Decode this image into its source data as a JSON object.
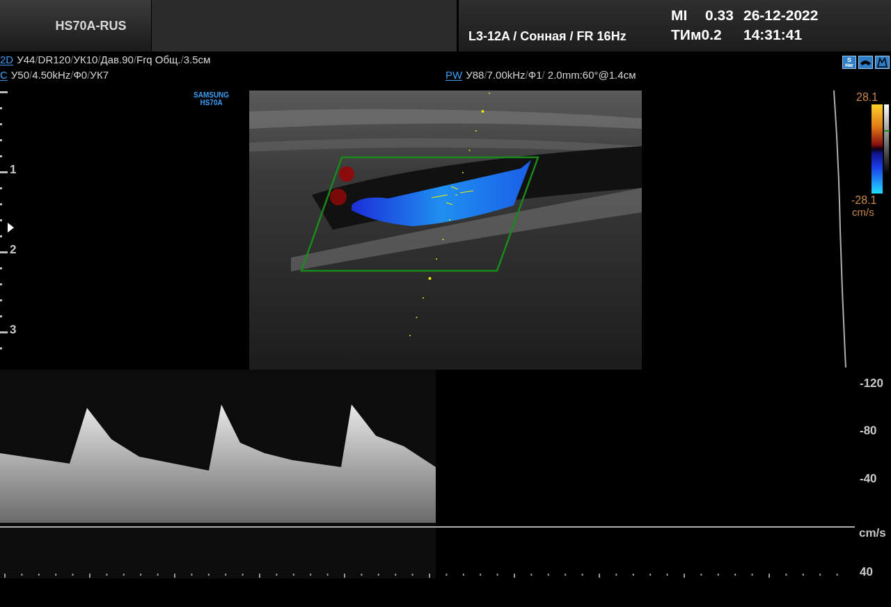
{
  "header": {
    "system": "HS70A-RUS",
    "probe_info": "L3-12A / Сонная / FR 16Hz",
    "mi_label": "MI",
    "mi_value": "0.33",
    "ti_label": "ТИм0.2",
    "date": "26-12-2022",
    "time": "14:31:41"
  },
  "params": [
    {
      "mode": "2D",
      "text": "У44/DR120/УК10/Дав.90/Frq Общ./3.5см"
    },
    {
      "mode": "C",
      "text": "У50/4.50kHz/Ф0/УК7"
    },
    {
      "mode": "PW",
      "text": "У88/7.00kHz/Ф1/ 2.0mm:60°@1.4см"
    }
  ],
  "harmonic_badge": {
    "top": "S",
    "bottom": "Har"
  },
  "logo": [
    "SAMSUNG",
    "HS70A"
  ],
  "depth_scale": [
    "1",
    "2",
    "3"
  ],
  "color_scale": {
    "max": "28.1",
    "min": "-28.1",
    "unit": "cm/s"
  },
  "velocity_scale": {
    "ticks": [
      "-120",
      "-80",
      "-40",
      "40"
    ],
    "unit": "cm/s"
  }
}
